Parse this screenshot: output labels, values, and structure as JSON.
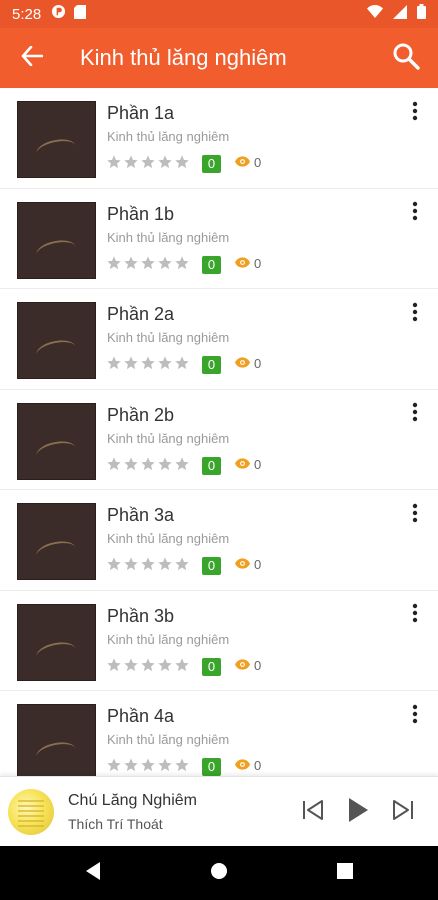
{
  "status_bar": {
    "time": "5:28",
    "left_icons": [
      "p-icon",
      "sd-card-icon"
    ],
    "right_icons": [
      "wifi-icon",
      "signal-icon",
      "battery-icon"
    ]
  },
  "app_bar": {
    "title": "Kinh thủ lăng nghiêm",
    "back_icon": "arrow-left-icon",
    "search_icon": "search-icon",
    "color": "#f25d2e"
  },
  "list": {
    "items": [
      {
        "title": "Phần 1a",
        "subtitle": "Kinh thủ lăng nghiêm",
        "rating": 0,
        "badge": "0",
        "views": "0"
      },
      {
        "title": "Phần 1b",
        "subtitle": "Kinh thủ lăng nghiêm",
        "rating": 0,
        "badge": "0",
        "views": "0"
      },
      {
        "title": "Phần 2a",
        "subtitle": "Kinh thủ lăng nghiêm",
        "rating": 0,
        "badge": "0",
        "views": "0"
      },
      {
        "title": "Phần 2b",
        "subtitle": "Kinh thủ lăng nghiêm",
        "rating": 0,
        "badge": "0",
        "views": "0"
      },
      {
        "title": "Phần 3a",
        "subtitle": "Kinh thủ lăng nghiêm",
        "rating": 0,
        "badge": "0",
        "views": "0"
      },
      {
        "title": "Phần 3b",
        "subtitle": "Kinh thủ lăng nghiêm",
        "rating": 0,
        "badge": "0",
        "views": "0"
      },
      {
        "title": "Phần 4a",
        "subtitle": "Kinh thủ lăng nghiêm",
        "rating": 0,
        "badge": "0",
        "views": "0"
      }
    ],
    "badge_color": "#3aa52b",
    "view_icon_color": "#f0a020"
  },
  "player": {
    "title": "Chú Lăng Nghiêm",
    "artist": "Thích Trí Thoát",
    "controls": [
      "previous-icon",
      "play-icon",
      "next-icon"
    ]
  },
  "nav_bar": {
    "buttons": [
      "back-triangle-icon",
      "home-circle-icon",
      "recents-square-icon"
    ]
  }
}
